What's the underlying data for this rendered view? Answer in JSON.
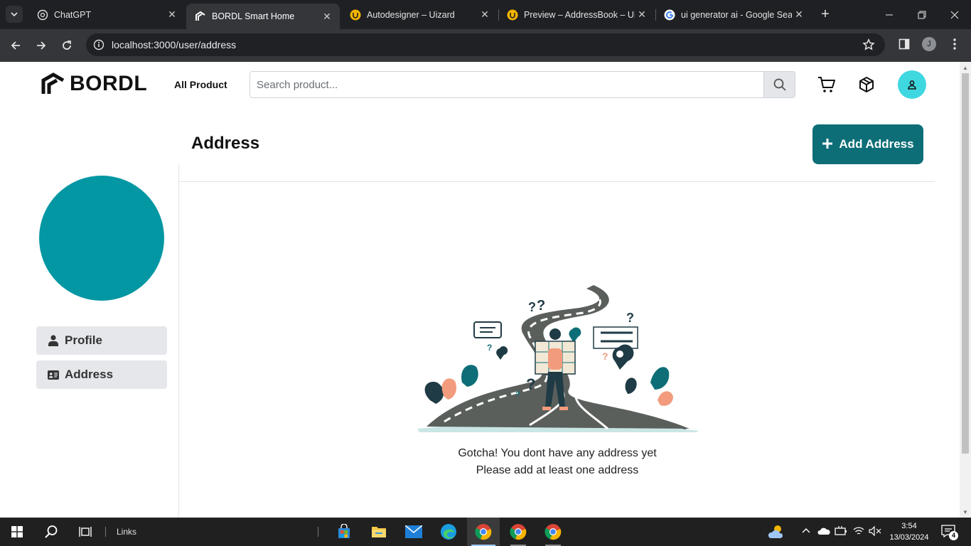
{
  "browser": {
    "tabs": [
      {
        "title": "ChatGPT",
        "icon": "chatgpt-icon",
        "active": false
      },
      {
        "title": "BORDL Smart Home",
        "icon": "bordl-icon",
        "active": true
      },
      {
        "title": "Autodesigner – Uizard",
        "icon": "uizard-icon",
        "active": false
      },
      {
        "title": "Preview – AddressBook – Uiz",
        "icon": "uizard-icon",
        "active": false
      },
      {
        "title": "ui generator ai - Google Sea",
        "icon": "google-icon",
        "active": false
      }
    ],
    "url": "localhost:3000/user/address",
    "profile_initial": "J"
  },
  "header": {
    "logo_text": "BORDL",
    "all_product_label": "All Product",
    "search_placeholder": "Search product...",
    "icons": [
      "cart-icon",
      "package-icon",
      "user-icon"
    ]
  },
  "page": {
    "title": "Address",
    "add_button_label": "Add Address"
  },
  "sidebar": {
    "items": [
      {
        "label": "Profile",
        "icon": "person-icon"
      },
      {
        "label": "Address",
        "icon": "address-card-icon"
      }
    ]
  },
  "empty_state": {
    "line1": "Gotcha! You dont have any address yet",
    "line2": "Please add at least one address"
  },
  "taskbar": {
    "links_label": "Links",
    "time": "3:54",
    "date": "13/03/2024",
    "notification_count": "4"
  },
  "colors": {
    "teal_dark": "#0e6e77",
    "teal_avatar": "#0397a3",
    "teal_light": "#3fd8e0"
  }
}
